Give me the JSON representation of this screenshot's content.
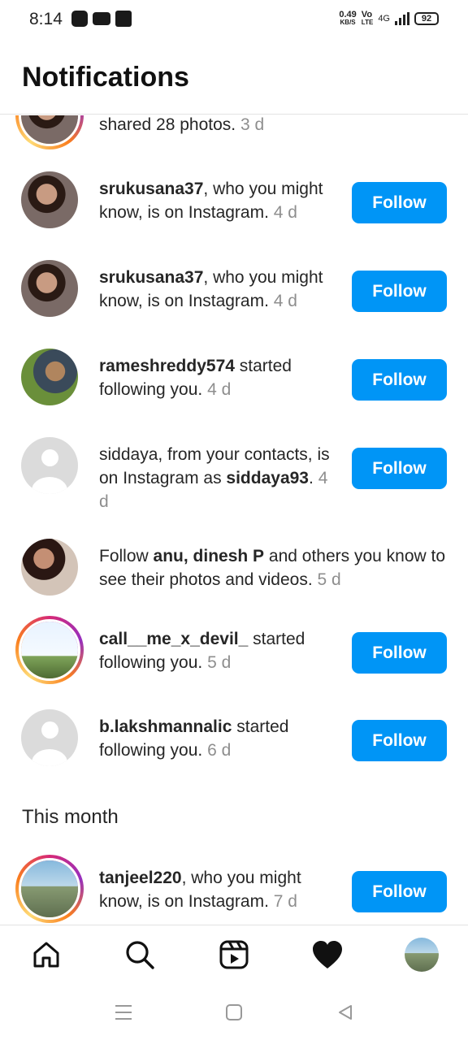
{
  "status_bar": {
    "time": "8:14",
    "net_speed_value": "0.49",
    "net_speed_unit": "KB/S",
    "volte_top": "Vo",
    "volte_bottom": "LTE",
    "network": "4G",
    "battery": "92"
  },
  "header": {
    "title": "Notifications"
  },
  "notifications": [
    {
      "text_before": "",
      "username": "",
      "text_after": "shared 28 photos.",
      "time": "3 d",
      "action": ""
    },
    {
      "text_before": "",
      "username": "srukusana37",
      "text_after": ", who you might know, is on Instagram.",
      "time": "4 d",
      "action": "Follow"
    },
    {
      "text_before": "",
      "username": "srukusana37",
      "text_after": ", who you might know, is on Instagram.",
      "time": "4 d",
      "action": "Follow"
    },
    {
      "text_before": "",
      "username": "rameshreddy574",
      "text_after": " started following you.",
      "time": "4 d",
      "action": "Follow"
    },
    {
      "text_before": "siddaya, from your contacts, is on Instagram as ",
      "username": "siddaya93",
      "text_after": ".",
      "time": "4 d",
      "action": "Follow"
    },
    {
      "text_before": "Follow ",
      "username": "anu",
      "mid": ", ",
      "username2": "dinesh P",
      "text_after": " and others you know to see their photos and videos.",
      "time": "5 d",
      "action": ""
    },
    {
      "text_before": "",
      "username": "call__me_x_devil_",
      "text_after": " started following you.",
      "time": "5 d",
      "action": "Follow"
    },
    {
      "text_before": "",
      "username": "b.lakshmannalic",
      "text_after": " started following you.",
      "time": "6 d",
      "action": "Follow"
    },
    {
      "text_before": "",
      "username": "tanjeel220",
      "text_after": ", who you might know, is on Instagram.",
      "time": "7 d",
      "action": "Follow"
    }
  ],
  "section_this_month": "This month",
  "bottom_nav": {
    "items": [
      "home-icon",
      "search-icon",
      "reels-icon",
      "heart-icon",
      "profile-avatar"
    ]
  },
  "system_nav": {
    "items": [
      "menu-icon",
      "home-square-icon",
      "back-icon"
    ]
  },
  "colors": {
    "accent": "#0095f6",
    "muted": "#8e8e8e",
    "text": "#262626"
  }
}
